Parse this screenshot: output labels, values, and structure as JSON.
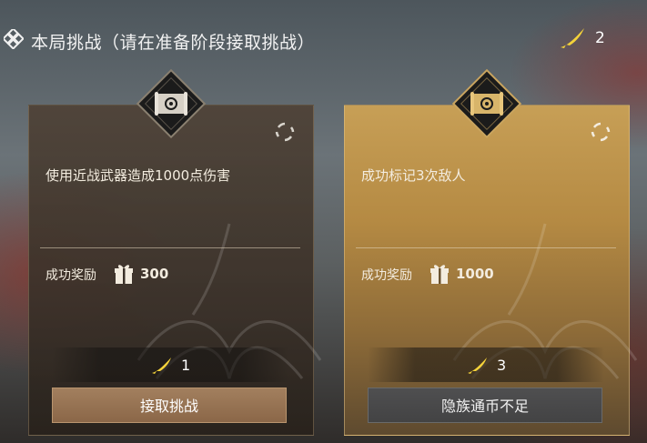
{
  "header": {
    "title": "本局挑战（请在准备阶段接取挑战）",
    "currency_icon": "yellow-feather-icon",
    "currency_count": "2"
  },
  "cards": [
    {
      "task": "使用近战武器造成1000点伤害",
      "reward_label": "成功奖励",
      "reward_icon": "gift-icon",
      "reward_amount": "300",
      "cost_icon": "yellow-feather-icon",
      "cost": "1",
      "button_label": "接取挑战"
    },
    {
      "task": "成功标记3次敌人",
      "reward_label": "成功奖励",
      "reward_icon": "gift-icon",
      "reward_amount": "1000",
      "cost_icon": "yellow-feather-icon",
      "cost": "3",
      "button_label": "隐族通币不足"
    }
  ],
  "colors": {
    "accent_gold": "#c79f56",
    "feather_yellow": "#f4d23a",
    "accept_button": "#9a7656",
    "disabled_button": "#4a4a4b"
  }
}
